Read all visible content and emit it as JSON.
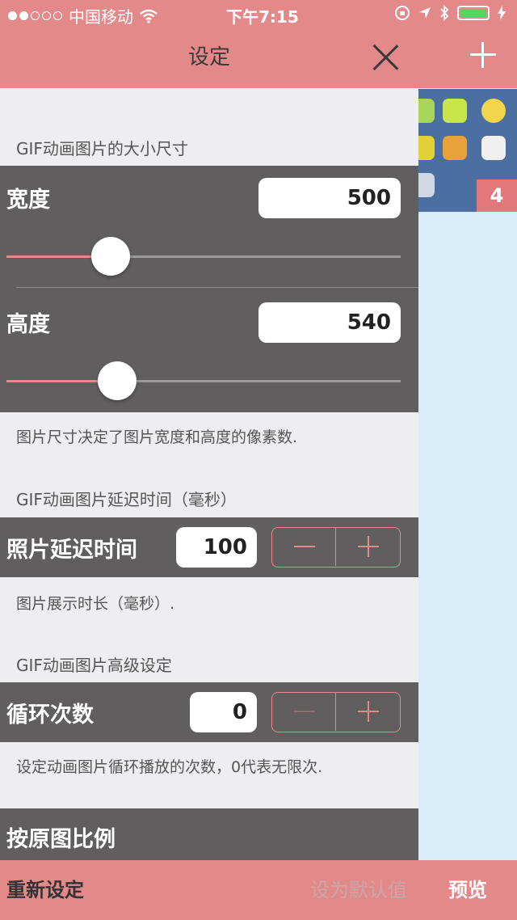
{
  "status_bar": {
    "carrier": "中国移动",
    "time": "下午7:15",
    "signal_dots_filled": 2,
    "signal_dots_total": 5
  },
  "nav": {
    "title": "设定",
    "close_icon": "close-icon"
  },
  "size_section": {
    "header": "GIF动画图片的大小尺寸",
    "width_label": "宽度",
    "width_value": "500",
    "height_label": "高度",
    "height_value": "540",
    "footer": "图片尺寸决定了图片宽度和高度的像素数."
  },
  "delay_section": {
    "header": "GIF动画图片延迟时间（毫秒）",
    "label": "照片延迟时间",
    "value": "100",
    "footer": "图片展示时长（毫秒）."
  },
  "advanced_section": {
    "header": "GIF动画图片高级设定",
    "loop_label": "循环次数",
    "loop_value": "0",
    "footer": "设定动画图片循环播放的次数，0代表无限次.",
    "ratio_label": "按原图比例"
  },
  "bottom_bar": {
    "reset": "重新设定",
    "set_default": "设为默认值",
    "preview": "预览"
  },
  "background": {
    "badge_count": "4"
  },
  "colors": {
    "accent": "#e4898a",
    "dark_row": "#605e5f",
    "light_bg": "#eeeef0",
    "side_bg": "#d8ecfa"
  }
}
